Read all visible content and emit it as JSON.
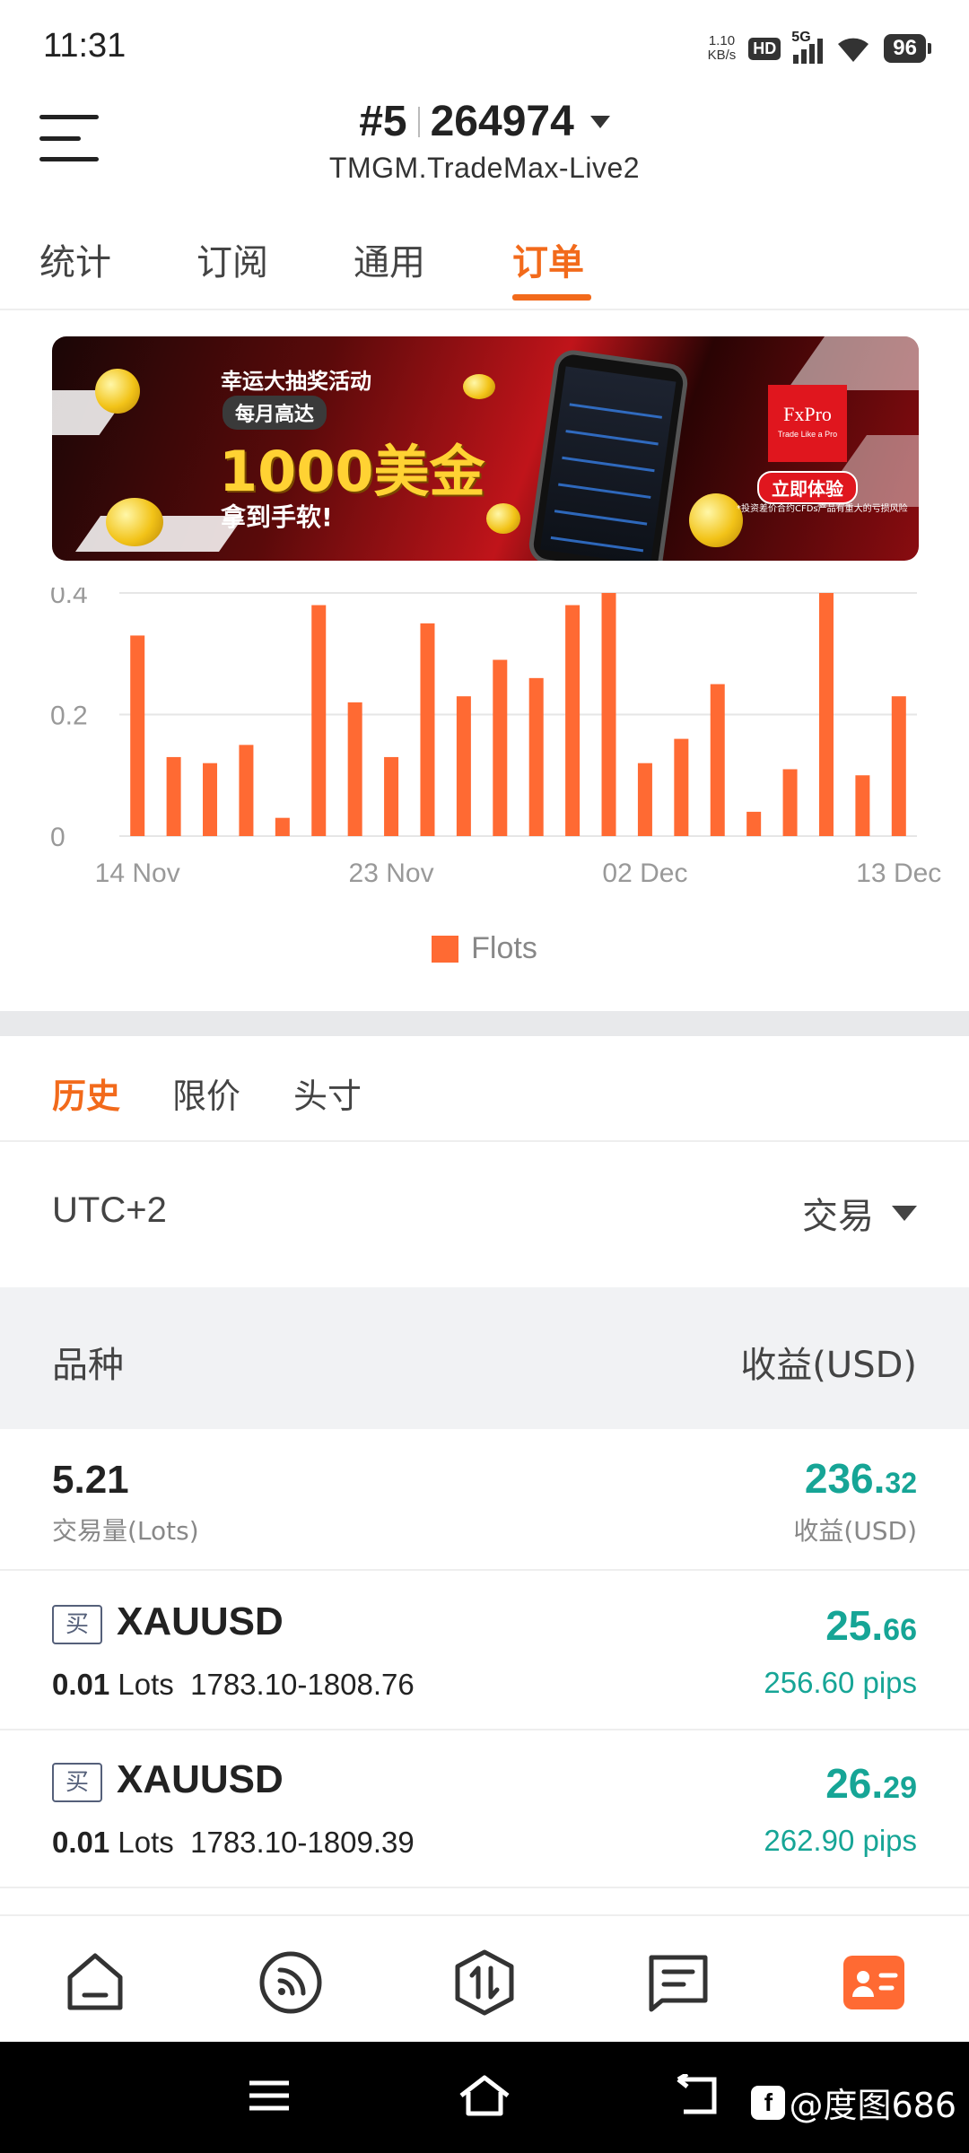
{
  "status_bar": {
    "time": "11:31",
    "net_speed_value": "1.10",
    "net_speed_unit": "KB/s",
    "hd": "HD",
    "network": "5G",
    "battery": "96"
  },
  "header": {
    "account_num": "#5",
    "account_id": "264974",
    "server": "TMGM.TradeMax-Live2"
  },
  "top_tabs": [
    {
      "label": "统计"
    },
    {
      "label": "订阅"
    },
    {
      "label": "通用"
    },
    {
      "label": "订单",
      "active": true
    }
  ],
  "banner": {
    "title": "幸运大抽奖活动",
    "pill": "每月高达",
    "amount": "1000美金",
    "subtitle": "拿到手软!",
    "brand": "FxPro",
    "brand_tagline": "Trade Like a Pro",
    "cta": "立即体验",
    "disclaimer": "*投资差价合约CFDs产品有重大的亏损风险"
  },
  "chart_data": {
    "type": "bar",
    "categories": [
      "14 Nov",
      "",
      "",
      "",
      "",
      "",
      "",
      "23 Nov",
      "",
      "",
      "",
      "",
      "",
      "",
      "02 Dec",
      "",
      "",
      "",
      "",
      "",
      "",
      "13 Dec",
      ""
    ],
    "series": [
      {
        "name": "Flots",
        "values": [
          0.33,
          0.13,
          0.12,
          0.15,
          0.03,
          0.38,
          0.22,
          0.13,
          0.35,
          0.23,
          0.29,
          0.26,
          0.38,
          0.4,
          0.12,
          0.16,
          0.25,
          0.04,
          0.11,
          0.4,
          0.1,
          0.23
        ]
      }
    ],
    "x_tick_labels": [
      "14 Nov",
      "23 Nov",
      "02 Dec",
      "13 Dec"
    ],
    "y_ticks": [
      "0",
      "0.2",
      "0.4"
    ],
    "ylim": [
      0,
      0.4
    ],
    "color": "#ff6a33",
    "grid": true,
    "legend_position": "bottom-center"
  },
  "sub_tabs": [
    {
      "label": "历史",
      "active": true
    },
    {
      "label": "限价"
    },
    {
      "label": "头寸"
    }
  ],
  "filter": {
    "timezone": "UTC+2",
    "type_select": "交易"
  },
  "table_header": {
    "left": "品种",
    "right": "收益(USD)"
  },
  "summary": {
    "lots": "5.21",
    "lots_label": "交易量(Lots)",
    "profit_int": "236.",
    "profit_dec": "32",
    "profit_label": "收益(USD)"
  },
  "orders": [
    {
      "side": "买",
      "symbol": "XAUUSD",
      "lots": "0.01",
      "lots_unit": "Lots",
      "price_range": "1783.10-1808.76",
      "profit_int": "25.",
      "profit_dec": "66",
      "pips": "256.60 pips"
    },
    {
      "side": "买",
      "symbol": "XAUUSD",
      "lots": "0.01",
      "lots_unit": "Lots",
      "price_range": "1783.10-1809.39",
      "profit_int": "26.",
      "profit_dec": "29",
      "pips": "262.90 pips"
    }
  ],
  "bottom_nav": [
    {
      "icon": "home-icon"
    },
    {
      "icon": "feed-icon"
    },
    {
      "icon": "trade-icon"
    },
    {
      "icon": "news-icon"
    },
    {
      "icon": "profile-icon",
      "active": true
    }
  ],
  "watermark": {
    "logo": "f",
    "text": "@度图686"
  },
  "colors": {
    "accent": "#f26a1b",
    "bar": "#ff6a33",
    "profit": "#16a596"
  }
}
